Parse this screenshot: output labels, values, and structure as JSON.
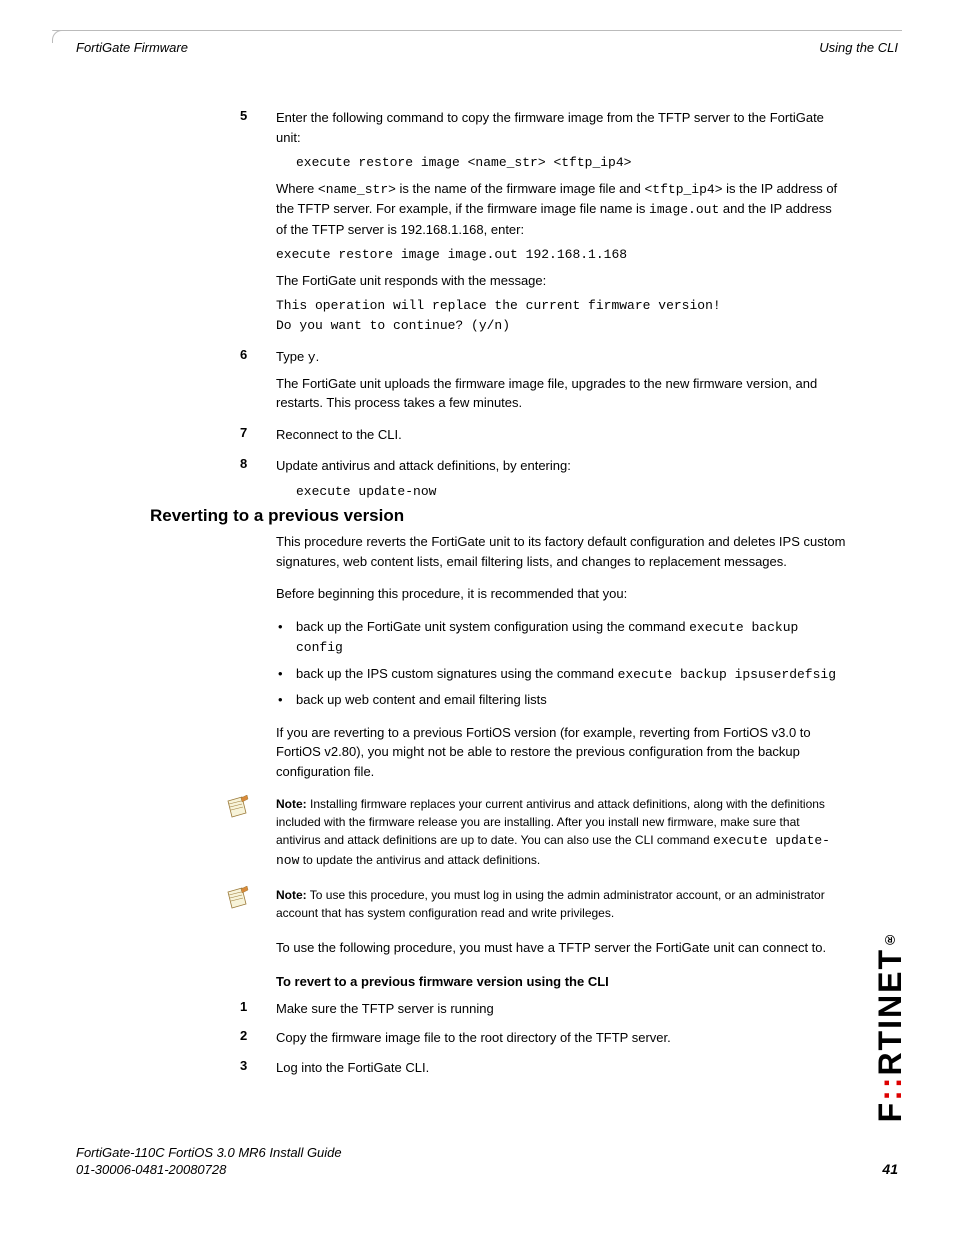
{
  "header": {
    "left": "FortiGate Firmware",
    "right": "Using the CLI"
  },
  "steps_a": {
    "s5": {
      "num": "5",
      "p1": "Enter the following command to copy the firmware image from the TFTP server to the FortiGate unit:",
      "code1": "execute restore image <name_str> <tftp_ip4>",
      "p2a": "Where ",
      "p2b": "<name_str>",
      "p2c": " is the name of the firmware image file and ",
      "p2d": "<tftp_ip4>",
      "p2e": " is the IP address of the TFTP server. For example, if the firmware image file name is ",
      "p2f": "image.out",
      "p2g": " and the IP address of the TFTP server is 192.168.1.168, enter:",
      "code2": "execute restore image image.out 192.168.1.168",
      "p3": "The FortiGate unit responds with the message:",
      "code3": "This operation will replace the current firmware version!",
      "code4": "Do you want to continue? (y/n)"
    },
    "s6": {
      "num": "6",
      "p1a": "Type ",
      "p1b": "y",
      "p1c": ".",
      "p2": "The FortiGate unit uploads the firmware image file, upgrades to the new firmware version, and restarts. This process takes a few minutes."
    },
    "s7": {
      "num": "7",
      "p1": "Reconnect to the CLI."
    },
    "s8": {
      "num": "8",
      "p1": "Update antivirus and attack definitions, by entering:",
      "code1": "execute update-now"
    }
  },
  "section": {
    "heading": "Reverting to a previous version",
    "p1": "This procedure reverts the FortiGate unit to its factory default configuration and deletes IPS custom signatures, web content lists, email filtering lists, and changes to replacement messages.",
    "p2": "Before beginning this procedure, it is recommended that you:",
    "bullets": {
      "b1a": "back up the FortiGate unit system configuration using the command ",
      "b1b": "execute backup config",
      "b2a": "back up the IPS custom signatures using the command ",
      "b2b": "execute backup ipsuserdefsig",
      "b3": "back up web content and email filtering lists"
    },
    "p3": "If you are reverting to a previous FortiOS version (for example, reverting from FortiOS v3.0 to FortiOS v2.80), you might not be able to restore the previous configuration from the backup configuration file.",
    "note1": {
      "label": "Note:",
      "text_a": " Installing firmware replaces your current antivirus and attack definitions, along with the definitions included with the firmware release you are installing. After you install new firmware, make sure that antivirus and attack definitions are up to date. You can also use the CLI command ",
      "text_b": "execute update-now",
      "text_c": " to update the antivirus and attack definitions."
    },
    "note2": {
      "label": "Note:",
      "text": " To use this procedure, you must log in using the admin administrator account, or an administrator account that has system configuration read and write privileges."
    },
    "p4": "To use the following procedure, you must have a TFTP server the FortiGate unit can connect to.",
    "subheading": "To revert to a previous firmware version using the CLI"
  },
  "steps_b": {
    "s1": {
      "num": "1",
      "p1": "Make sure the TFTP server is running"
    },
    "s2": {
      "num": "2",
      "p1": "Copy the firmware image file to the root directory of the TFTP server."
    },
    "s3": {
      "num": "3",
      "p1": "Log into the FortiGate CLI."
    }
  },
  "footer": {
    "line1": "FortiGate-110C FortiOS 3.0 MR6 Install Guide",
    "line2": "01-30006-0481-20080728",
    "page": "41"
  },
  "logo": "F   RTINET",
  "logo_dots": "::"
}
